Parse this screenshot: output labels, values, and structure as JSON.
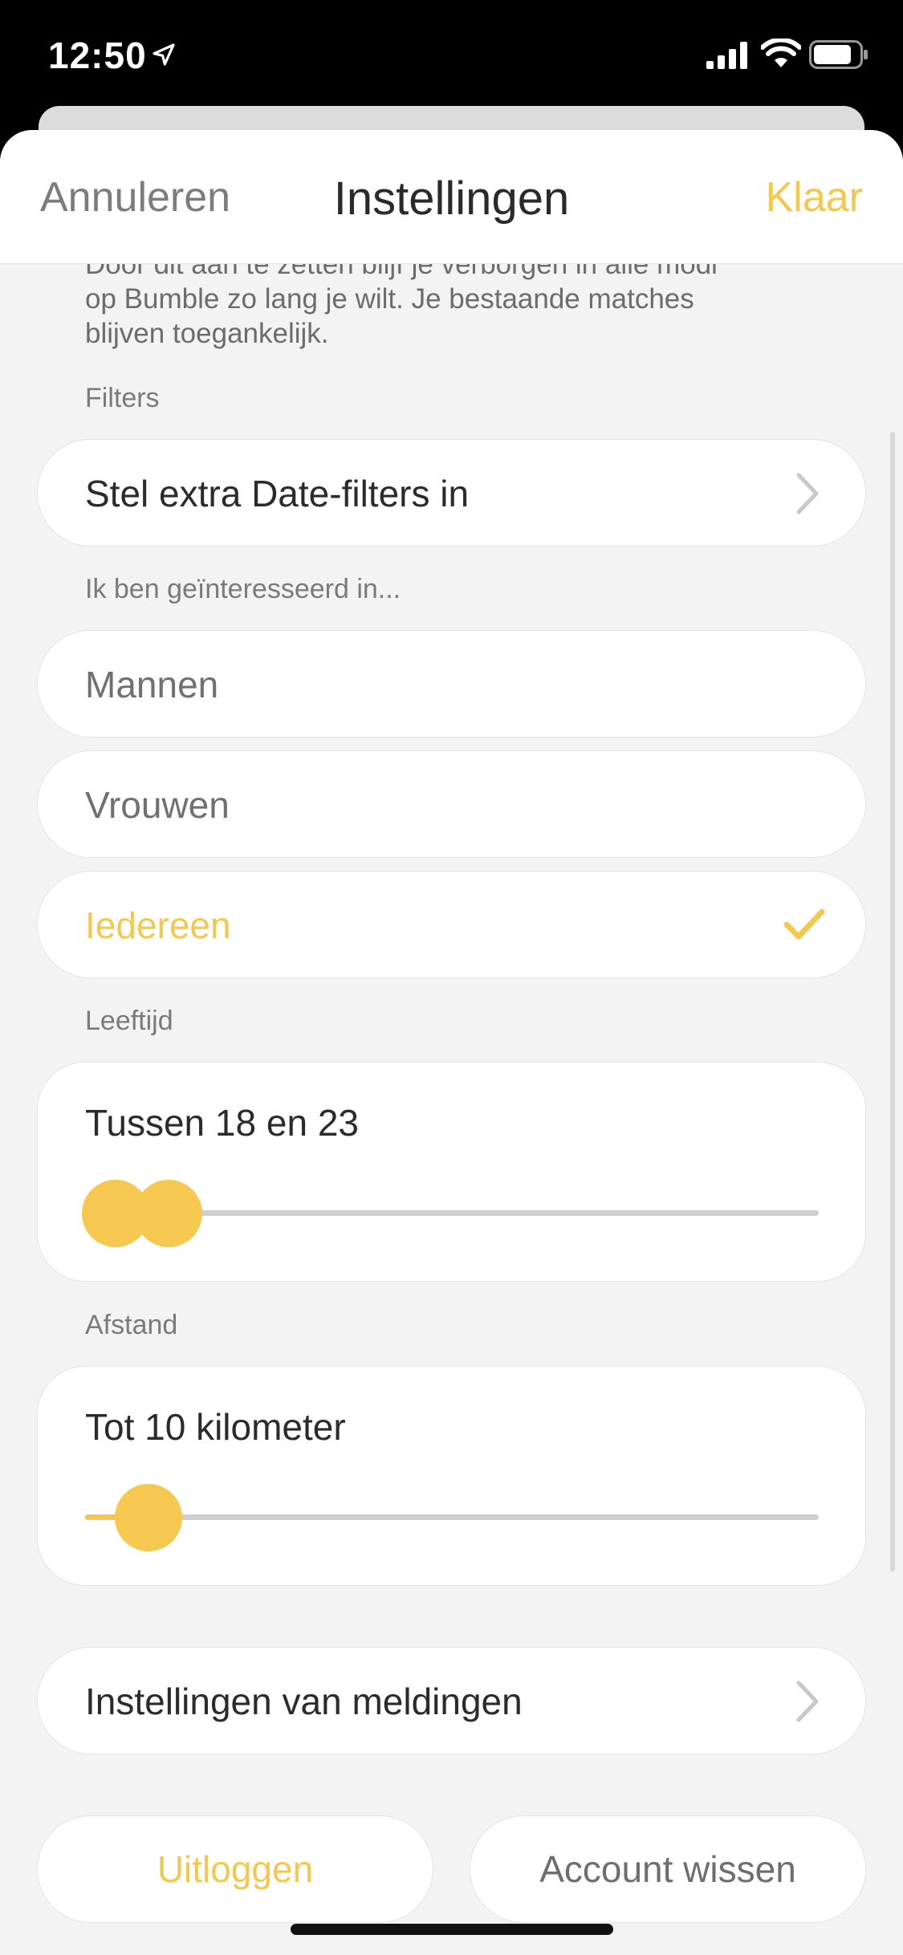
{
  "status_bar": {
    "time": "12:50"
  },
  "nav": {
    "cancel": "Annuleren",
    "title": "Instellingen",
    "done": "Klaar"
  },
  "clipped_text": {
    "line1": "Door dit aan te zetten blijf je verborgen in alle modi",
    "line2": "op Bumble zo lang je wilt. Je bestaande matches",
    "line3": "blijven toegankelijk."
  },
  "filters": {
    "label": "Filters",
    "row": "Stel extra Date-filters in"
  },
  "interest": {
    "label": "Ik ben geïnteresseerd in...",
    "options": [
      "Mannen",
      "Vrouwen",
      "Iedereen"
    ],
    "selected": "Iedereen"
  },
  "age": {
    "label": "Leeftijd",
    "value_text": "Tussen 18 en 23",
    "min": 18,
    "max": 23
  },
  "distance": {
    "label": "Afstand",
    "value_text": "Tot 10 kilometer",
    "km": 10
  },
  "notifications": {
    "row": "Instellingen van meldingen"
  },
  "buttons": {
    "logout": "Uitloggen",
    "delete": "Account wissen"
  },
  "colors": {
    "accent": "#f4c84e",
    "background": "#f3f3f3",
    "muted_text": "#7a7a7a"
  },
  "icons": [
    "location-arrow-icon",
    "signal-icon",
    "wifi-icon",
    "battery-icon",
    "chevron-right-icon",
    "checkmark-icon"
  ]
}
